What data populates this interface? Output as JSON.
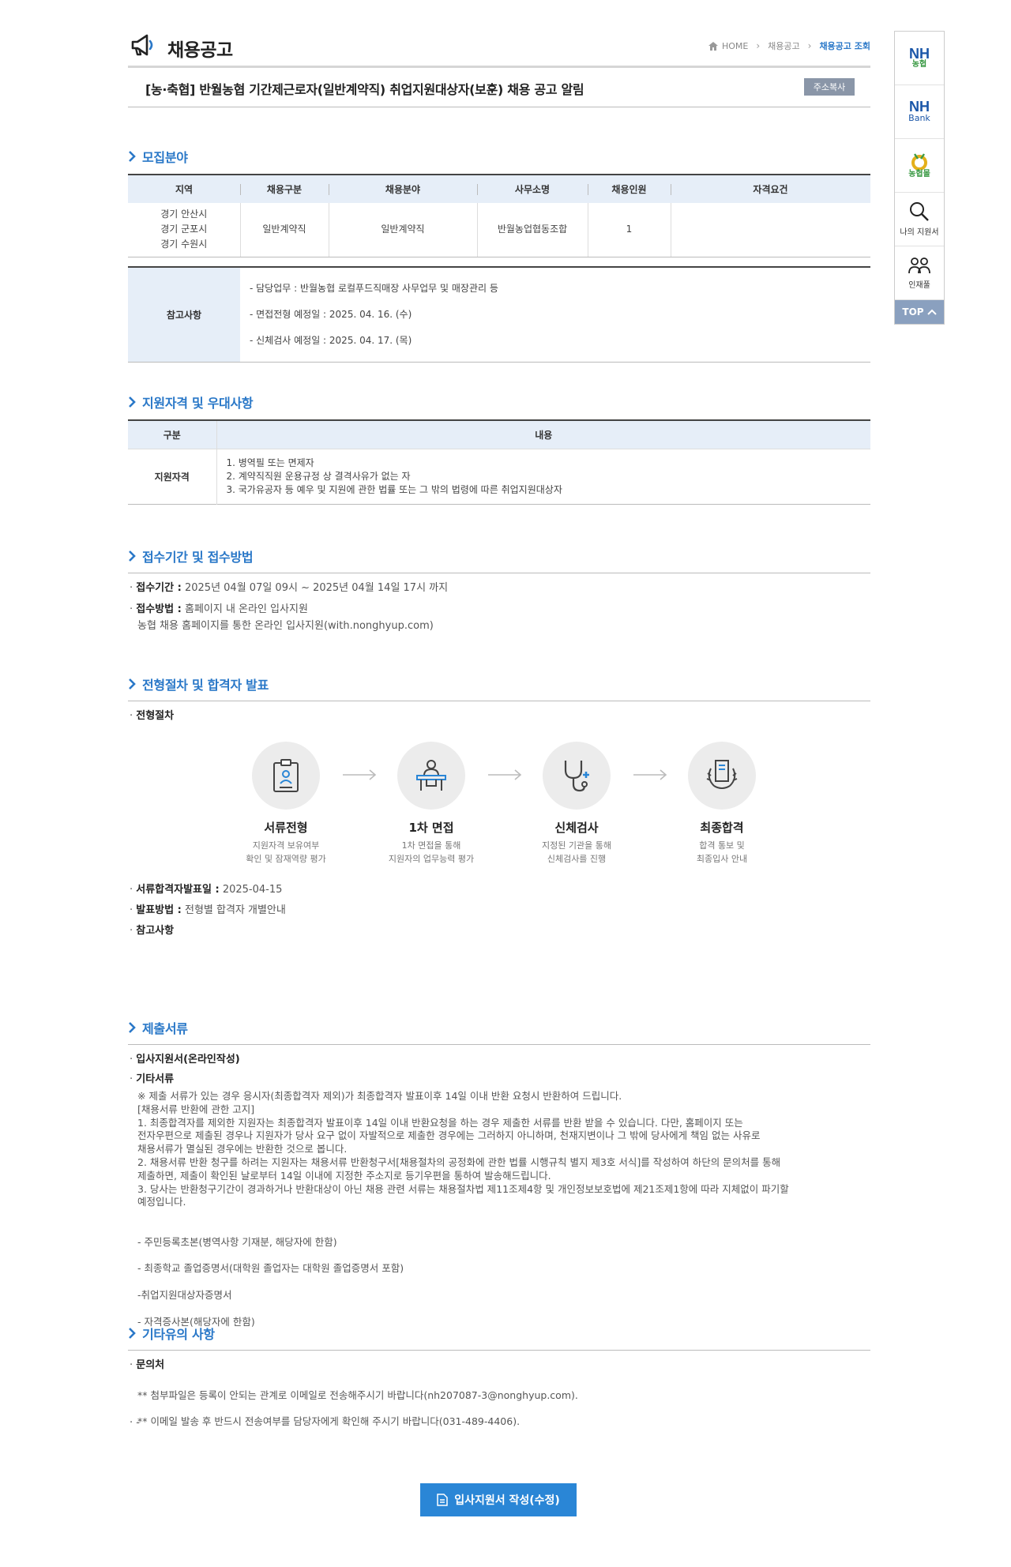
{
  "header": {
    "title": "채용공고",
    "breadcrumb": [
      "HOME",
      "채용공고",
      "채용공고 조회"
    ]
  },
  "post": {
    "title": "[농·축협] 반월농협 기간제근로자(일반계약직) 취업지원대상자(보훈) 채용 공고 알림",
    "copy_label": "주소복사"
  },
  "recruit": {
    "heading": "모집분야",
    "columns": [
      "지역",
      "채용구분",
      "채용분야",
      "사무소명",
      "채용인원",
      "자격요건"
    ],
    "row": {
      "region": [
        "경기 안산시",
        "경기 군포시",
        "경기 수원시"
      ],
      "type": "일반계약직",
      "field": "일반계약직",
      "office": "반월농업협동조합",
      "count": "1",
      "qualification": ""
    },
    "notes_label": "참고사항",
    "notes": [
      "- 담당업무 : 반월농협 로컬푸드직매장 사무업무 및 매장관리 등",
      "- 면접전형 예정일 : 2025. 04. 16. (수)",
      "- 신체검사 예정일 : 2025. 04. 17. (목)"
    ]
  },
  "eligibility": {
    "heading": "지원자격 및 우대사항",
    "columns": [
      "구분",
      "내용"
    ],
    "label": "지원자격",
    "items": [
      "1. 병역필 또는 면제자",
      "2. 계약직직원 운용규정 상 결격사유가 없는 자",
      "3. 국가유공자 등 예우 및 지원에 관한 법률 또는 그 밖의 법령에 따른 취업지원대상자"
    ]
  },
  "application": {
    "heading": "접수기간 및 접수방법",
    "period_label": "접수기간 :",
    "period": "2025년 04월 07일 09시 ~ 2025년 04월 14일 17시 까지",
    "method_label": "접수방법 :",
    "method": "홈페이지 내 온라인 입사지원",
    "method_detail": "농협 채용 홈페이지를 통한 온라인 입사지원(with.nonghyup.com)"
  },
  "process": {
    "heading": "전형절차 및 합격자 발표",
    "sub_label": "전형절차",
    "steps": [
      {
        "name": "서류전형",
        "desc1": "지원자격 보유여부",
        "desc2": "확인 및 잠재역량 평가"
      },
      {
        "name": "1차 면접",
        "desc1": "1차 면접을 통해",
        "desc2": "지원자의 업무능력 평가"
      },
      {
        "name": "신체검사",
        "desc1": "지정된 기관을 통해",
        "desc2": "신체검사를 진행"
      },
      {
        "name": "최종합격",
        "desc1": "합격 통보 및",
        "desc2": "최종입사 안내"
      }
    ],
    "announce_label": "서류합격자발표일 :",
    "announce": "2025-04-15",
    "method_label": "발표방법 :",
    "method": "전형별 합격자 개별안내",
    "notes_label": "참고사항"
  },
  "documents": {
    "heading": "제출서류",
    "item1": "입사지원서(온라인작성)",
    "item2": "기타서류",
    "body": "※ 제출 서류가 있는 경우 응시자(최종합격자 제외)가 최종합격자 발표이후 14일 이내 반환 요청시 반환하여 드립니다.\n[채용서류 반환에 관한 고지]\n 1. 최종합격자를 제외한 지원자는 최종합격자 발표이후 14일 이내 반환요청을 하는 경우 제출한 서류를 반환 받을 수 있습니다. 다만, 홈페이지 또는\n전자우편으로 제출된 경우나 지원자가 당사 요구 없이 자발적으로 제출한 경우에는 그러하지 아니하며, 천재지변이나 그 밖에 당사에게 책임 없는 사유로\n채용서류가 멸실된 경우에는 반환한 것으로 봅니다.\n 2. 채용서류 반환 청구를 하려는 지원자는 채용서류 반환청구서[채용절차의 공정화에 관한 법률 시행규칙 별지 제3호 서식]를 작성하여 하단의 문의처를 통해\n제출하면, 제출이 확인된 날로부터 14일 이내에 지정한 주소지로 등기우편을 통하여 발송해드립니다.\n 3. 당사는 반환청구기간이 경과하거나 반환대상이 아닌 채용 관련 서류는 채용절차법 제11조제4항 및 개인정보보호법에 제21조제1항에 따라 지체없이 파기할\n예정입니다.",
    "list": [
      "- 주민등록초본(병역사항 기재분, 해당자에 한함)",
      "- 최종학교 졸업증명서(대학원 졸업자는 대학원 졸업증명서 포함)",
      " -취업지원대상자증명서",
      "- 자격증사본(해당자에 한함)"
    ]
  },
  "other": {
    "heading": "기타유의 사항",
    "contact_label": "문의처",
    "lines": [
      "** 첨부파일은 등록이 안되는 관계로 이메일로 전송해주시기 바랍니다(nh207087-3@nonghyup.com).",
      "** 이메일 발송 후 반드시 전송여부를 담당자에게 확인해 주시기 바랍니다(031-489-4406)."
    ],
    "trailing": "-"
  },
  "apply_button": "입사지원서 작성(수정)",
  "quick": {
    "nh_logo": "NH",
    "nh_sub": "농협",
    "bank_logo": "NH",
    "bank_sub": "Bank",
    "mall_sub": "농협몰",
    "my_apply": "나의 지원서",
    "talent": "인재풀",
    "top": "TOP"
  },
  "colors": {
    "accent": "#2a78c8",
    "button": "#2a86d6",
    "table_header": "#e6eef8"
  }
}
